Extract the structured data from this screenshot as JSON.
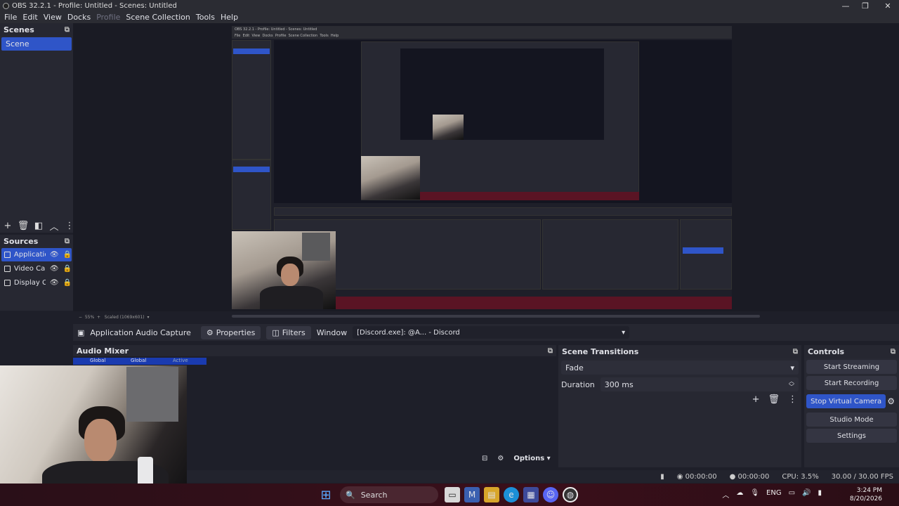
{
  "window": {
    "title": "OBS 32.2.1 - Profile: Untitled - Scenes: Untitled",
    "controls": {
      "minimize": "—",
      "maximize": "❐",
      "close": "✕"
    }
  },
  "menu": [
    "File",
    "Edit",
    "View",
    "Docks",
    "Profile",
    "Scene Collection",
    "Tools",
    "Help"
  ],
  "scenes": {
    "title": "Scenes",
    "items": [
      "Scene"
    ]
  },
  "sources": {
    "title": "Sources",
    "items": [
      {
        "label": "Applicatio",
        "selected": true
      },
      {
        "label": "Video Cap",
        "selected": false
      },
      {
        "label": "Display Ca",
        "selected": false
      }
    ]
  },
  "preview": {
    "zoom": "55%",
    "scaled": "Scaled (1069x601)",
    "nested_title": "OBS 32.2.1 - Profile: Untitled - Scenes: Untitled",
    "nested_menu": [
      "File",
      "Edit",
      "View",
      "Docks",
      "Profile",
      "Scene Collection",
      "Tools",
      "Help"
    ]
  },
  "source_toolbar": {
    "source_name": "Application Audio Capture",
    "properties": "Properties",
    "filters": "Filters",
    "window_label": "Window",
    "window_value": "[Discord.exe]: @A... - Discord"
  },
  "audio_mixer": {
    "title": "Audio Mixer",
    "channels": [
      "Global",
      "Global",
      "Active"
    ],
    "options_label": "Options"
  },
  "scene_transitions": {
    "title": "Scene Transitions",
    "transition": "Fade",
    "duration_label": "Duration",
    "duration_value": "300 ms"
  },
  "controls": {
    "title": "Controls",
    "buttons": [
      "Start Streaming",
      "Start Recording",
      "Stop Virtual Camera",
      "Studio Mode",
      "Settings"
    ]
  },
  "status": {
    "stream_time": "00:00:00",
    "rec_time": "00:00:00",
    "cpu": "CPU: 3.5%",
    "fps": "30.00 / 30.00 FPS"
  },
  "taskbar": {
    "search": "Search",
    "language": "ENG",
    "time": "3:24 PM",
    "date": "8/20/2026"
  },
  "colors": {
    "accent": "#2f55c8",
    "bg": "#1e1f29",
    "panel": "#272832"
  }
}
